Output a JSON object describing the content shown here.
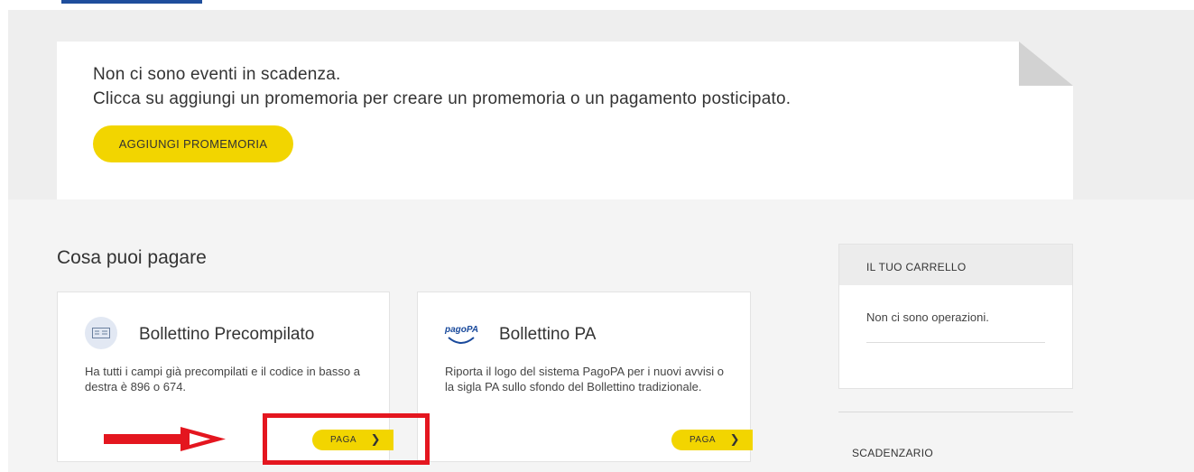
{
  "reminders": {
    "empty_line1": "Non ci sono eventi in scadenza.",
    "empty_line2": "Clicca su aggiungi un promemoria per creare un promemoria o un pagamento posticipato.",
    "add_button_label": "AGGIUNGI PROMEMORIA"
  },
  "payables": {
    "section_title": "Cosa puoi pagare",
    "cards": [
      {
        "title": "Bollettino Precompilato",
        "description": "Ha tutti i campi già precompilati e il codice in basso a destra è 896 o 674.",
        "button_label": "PAGA",
        "icon": "bollettino-icon"
      },
      {
        "title": "Bollettino PA",
        "description": "Riporta il logo del sistema PagoPA per i nuovi avvisi o la sigla PA sullo sfondo del Bollettino tradizionale.",
        "button_label": "PAGA",
        "icon": "pagopa-logo",
        "logo_text": "pagoPA"
      }
    ]
  },
  "cart": {
    "title": "IL TUO CARRELLO",
    "empty_text": "Non ci sono operazioni."
  },
  "scadenzario": {
    "title": "SCADENZARIO"
  },
  "colors": {
    "accent_yellow": "#f2d500",
    "highlight_red": "#e4161f",
    "tab_blue": "#1f4e9c"
  }
}
